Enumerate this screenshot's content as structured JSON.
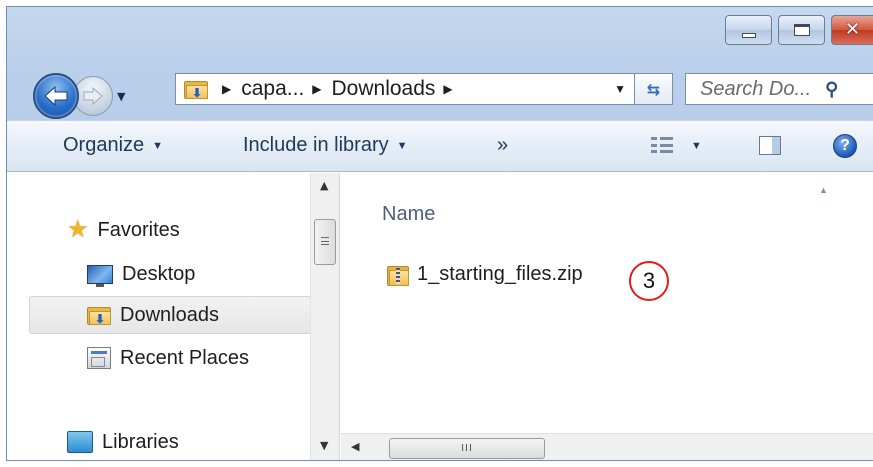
{
  "window": {
    "caption": {
      "minimize_glyph": "min",
      "maximize_glyph": "max",
      "close_glyph": "✕"
    }
  },
  "address": {
    "crumbs": [
      "capa...",
      "Downloads"
    ],
    "dropdown": "▼"
  },
  "search": {
    "placeholder": "Search Do..."
  },
  "commandbar": {
    "organize_label": "Organize",
    "include_label": "Include in library",
    "more_label": "»"
  },
  "navpane": {
    "items": [
      {
        "label": "Favorites",
        "icon": "star-icon"
      },
      {
        "label": "Desktop",
        "icon": "desktop-icon"
      },
      {
        "label": "Downloads",
        "icon": "downloads-folder-icon",
        "selected": true
      },
      {
        "label": "Recent Places",
        "icon": "recent-places-icon"
      },
      {
        "label": "Libraries",
        "icon": "libraries-icon"
      }
    ]
  },
  "content": {
    "column_name": "Name",
    "files": [
      {
        "name": "1_starting_files.zip",
        "icon": "zip-folder-icon"
      }
    ]
  },
  "annotation": {
    "callout_number": "3"
  },
  "colors": {
    "callout_border": "#e01d1d",
    "chrome": "#bcd1eb",
    "close_button": "#c03a22"
  }
}
